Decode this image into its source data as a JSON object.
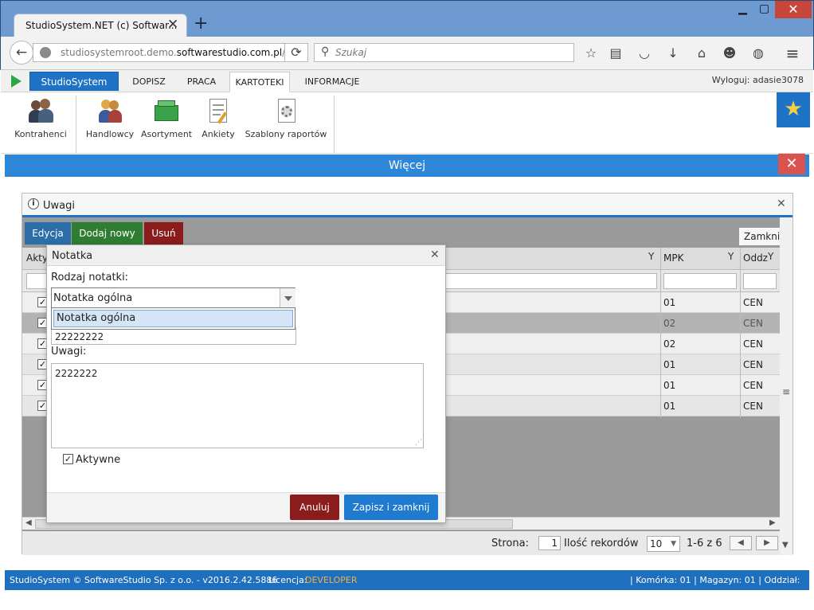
{
  "browser": {
    "tab_title": "StudioSystem.NET (c) Softwar...",
    "url_prefix": "studiosystemroot.demo.",
    "url_domain": "softwarestudio.com.pl",
    "url_suffix": "/",
    "search_placeholder": "Szukaj"
  },
  "app": {
    "brand": "StudioSystem",
    "menu": [
      "DOPISZ",
      "PRACA",
      "KARTOTEKI",
      "INFORMACJE"
    ],
    "logout": "Wyloguj: adasie3078",
    "ribbon": [
      "Kontrahenci",
      "Handlowcy",
      "Asortyment",
      "Ankiety",
      "Szablony raportów"
    ],
    "more_bar": "Więcej"
  },
  "uwagi": {
    "title": "Uwagi",
    "buttons": {
      "edit": "Edycja",
      "add": "Dodaj nowy",
      "delete": "Usuń"
    },
    "tooltip": "Zamknij",
    "columns": {
      "active": "Akty",
      "mpk": "MPK",
      "branch": "Oddz"
    },
    "rows": [
      {
        "mpk": "01",
        "branch": "CEN",
        "checked": true
      },
      {
        "mpk": "02",
        "branch": "CEN",
        "checked": true
      },
      {
        "mpk": "02",
        "branch": "CEN",
        "checked": true
      },
      {
        "mpk": "01",
        "branch": "CEN",
        "checked": true
      },
      {
        "mpk": "01",
        "branch": "CEN",
        "checked": true
      },
      {
        "mpk": "01",
        "branch": "CEN",
        "checked": true
      }
    ],
    "pager": {
      "page_label": "Strona:",
      "page": "1",
      "records_label": "Ilość rekordów",
      "page_size": "10",
      "range": "1-6 z 6"
    }
  },
  "dialog": {
    "title": "Notatka",
    "type_label": "Rodzaj notatki:",
    "type_value": "Notatka ogólna",
    "dropdown_option": "Notatka ogólna",
    "number_value": "22222222",
    "notes_label": "Uwagi:",
    "notes_value": "2222222",
    "active_label": "Aktywne",
    "cancel": "Anuluj",
    "save": "Zapisz i zamknij"
  },
  "footer": {
    "copyright": "StudioSystem © SoftwareStudio Sp. z o.o. - v2016.2.42.5886",
    "license_label": "Licencja:",
    "license_value": "DEVELOPER",
    "status": "| Komórka: 01 | Magazyn: 01 | Oddział: CEN"
  },
  "colors": {
    "accent": "#1e73c6",
    "danger": "#8b1c1c",
    "success": "#2e7d32"
  }
}
